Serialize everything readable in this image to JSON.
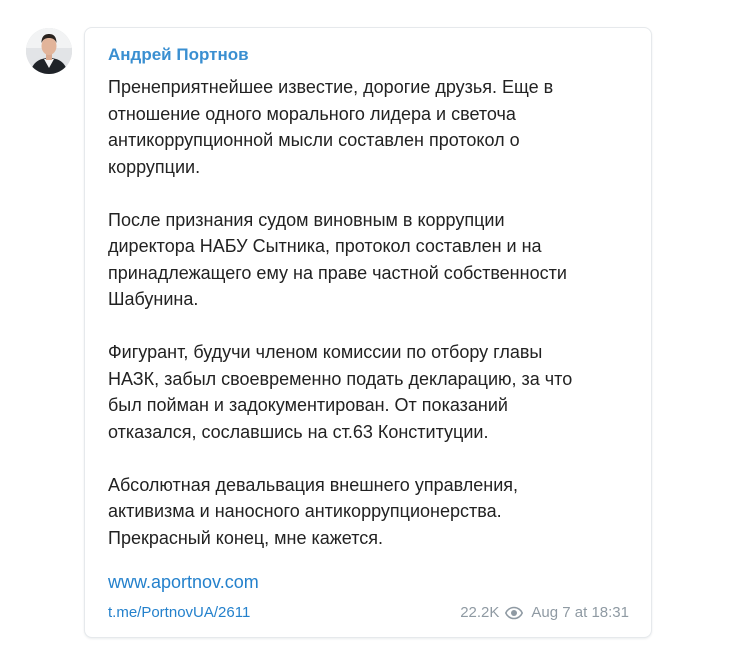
{
  "post": {
    "author": "Андрей Портнов",
    "paragraphs": [
      "Пренеприятнейшее известие, дорогие друзья. Еще в\nотношение одного морального лидера и светоча\nантикоррупционной мысли составлен протокол о\nкоррупции.",
      "После признания судом виновным в коррупции\nдиректора НАБУ Сытника, протокол составлен и на\nпринадлежащего ему на праве частной собственности\nШабунина.",
      "Фигурант, будучи членом комиссии по отбору главы\nНАЗК, забыл своевременно подать декларацию, за что\nбыл пойман и задокументирован. От показаний\nотказался, сославшись на ст.63 Конституции.",
      "Абсолютная девальвация внешнего управления,\nактивизма и наносного антикоррупционерства.\nПрекрасный конец, мне кажется."
    ],
    "site_link": "www.aportnov.com",
    "post_link": "t.me/PortnovUA/2611",
    "views": "22.2K",
    "date": "Aug 7 at 18:31"
  },
  "icons": {
    "avatar": "author-avatar",
    "views": "eye-icon"
  },
  "colors": {
    "author_name": "#3a8fd1",
    "link": "#2481cc",
    "text": "#222222",
    "meta": "#8f9aa3",
    "bubble_border": "#e6e9ec"
  }
}
